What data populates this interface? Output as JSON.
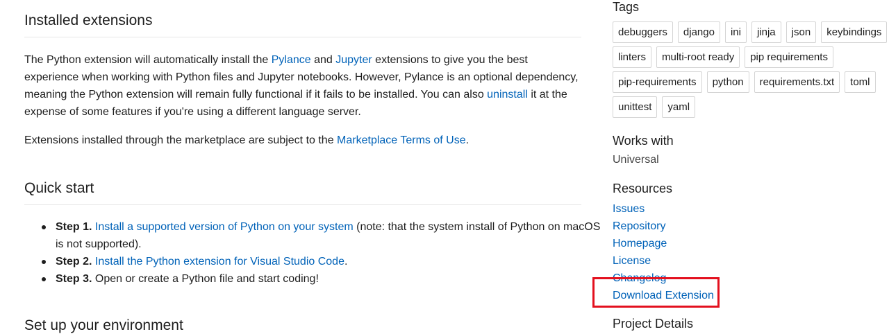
{
  "main": {
    "installed_heading": "Installed extensions",
    "para1": {
      "t1": "The Python extension will automatically install the ",
      "link_pylance": "Pylance",
      "t2": " and ",
      "link_jupyter": "Jupyter",
      "t3": " extensions to give you the best experience when working with Python files and Jupyter notebooks. However, Pylance is an optional dependency, meaning the Python extension will remain fully functional if it fails to be installed. You can also ",
      "link_uninstall": "uninstall",
      "t4": " it at the expense of some features if you're using a different language server."
    },
    "para2": {
      "t1": "Extensions installed through the marketplace are subject to the ",
      "link_terms": "Marketplace Terms of Use",
      "t2": "."
    },
    "quickstart_heading": "Quick start",
    "steps": [
      {
        "label": "Step 1.",
        "link": "Install a supported version of Python on your system",
        "text": " (note: that the system install of Python on macOS is not supported)."
      },
      {
        "label": "Step 2.",
        "link": "Install the Python extension for Visual Studio Code",
        "text": "."
      },
      {
        "label": "Step 3.",
        "link": "",
        "text": "Open or create a Python file and start coding!"
      }
    ],
    "setup_heading": "Set up your environment"
  },
  "sidebar": {
    "tags_heading": "Tags",
    "tags": [
      [
        "debuggers",
        "django",
        "ini",
        "jinja",
        "json",
        "keybindings"
      ],
      [
        "linters",
        "multi-root ready",
        "pip requirements"
      ],
      [
        "pip-requirements",
        "python",
        "requirements.txt",
        "toml"
      ],
      [
        "unittest",
        "yaml"
      ]
    ],
    "works_with_heading": "Works with",
    "works_with_value": "Universal",
    "resources_heading": "Resources",
    "resources": [
      "Issues",
      "Repository",
      "Homepage",
      "License",
      "Changelog",
      "Download Extension"
    ],
    "project_details_heading": "Project Details"
  },
  "colors": {
    "link": "#0062b8",
    "highlight_box": "#e3101e"
  }
}
